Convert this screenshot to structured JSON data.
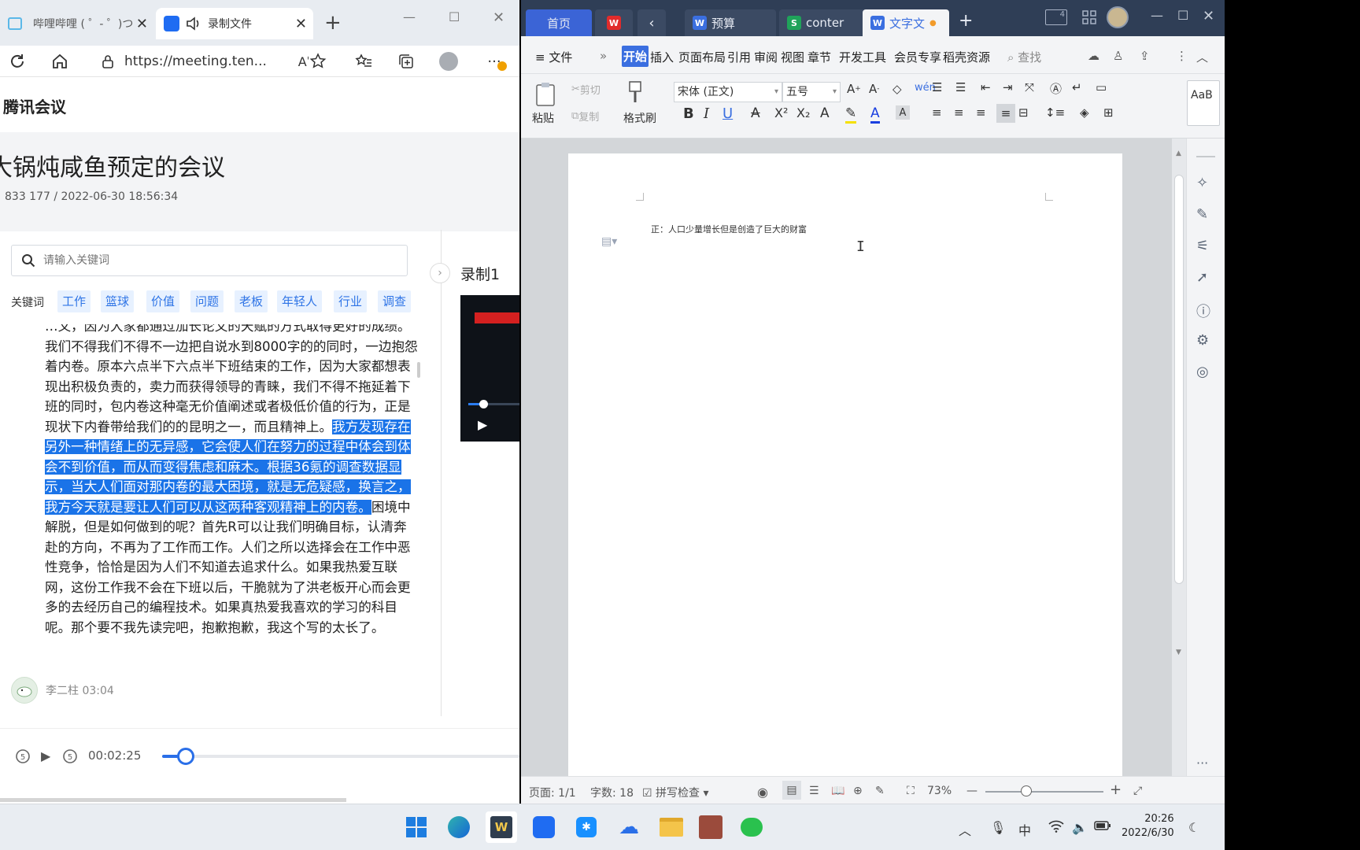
{
  "browser": {
    "tabs": [
      {
        "label": "哔哩哔哩 ( ゜- ゜)つ",
        "icon": "bilibili-icon"
      },
      {
        "label": "录制文件",
        "icon": "tencent-meeting-icon"
      }
    ],
    "url": "https://meeting.ten..."
  },
  "meeting": {
    "brand": "腾讯会议",
    "title": "大锅炖咸鱼预定的会议",
    "meta": "833 177 / 2022-06-30 18:56:34",
    "search_placeholder": "请输入关键词",
    "keywords_label": "关键词",
    "keywords": [
      "工作",
      "篮球",
      "价值",
      "问题",
      "老板",
      "年轻人",
      "行业",
      "调查"
    ],
    "transcript_before": "…文，因为大家都通过加长论文的天赋的方式取得更好的成绩。我们不得我们不得不一边把自说水到8000字的的同时，一边抱怨着内卷。原本六点半下六点半下班结束的工作，因为大家都想表现出积极负责的，卖力而获得领导的青睐，我们不得不拖延着下班的同时，包内卷这种毫无价值阐述或者极低价值的行为，正是现状下内眷带给我们的的昆明之一，而且精神上。",
    "transcript_highlight": "我方发现存在另外一种情绪上的无异感，它会使人们在努力的过程中体会到体会不到价值，而从而变得焦虑和麻木。根据36氪的调查数据显示，当大人们面对那内卷的最大困境，就是无危疑感，换言之，我方今天就是要让人们可以从这两种客观精神上的内卷。",
    "transcript_after": "困境中解脱，但是如何做到的呢？首先R可以让我们明确目标，认清奔赴的方向，不再为了工作而工作。人们之所以选择会在工作中恶性竞争，恰恰是因为人们不知道去追求什么。如果我热爱互联网，这份工作我不会在下班以后，干脆就为了洪老板开心而会更多的去经历自己的编程技术。如果真热爱我喜欢的学习的科目呢。那个要不我先读完吧，抱歉抱歉，我这个写的太长了。",
    "speaker": "李二柱 03:04",
    "recording_title": "录制1",
    "player_time": "00:02:25",
    "progress_fraction": 0.02
  },
  "wps": {
    "tabs": [
      {
        "label": "首页",
        "icon": ""
      },
      {
        "label": "",
        "icon": "wps-red-icon"
      },
      {
        "label": "预算",
        "icon": "wps-writer-icon"
      },
      {
        "label": "conter",
        "icon": "wps-sheet-icon"
      },
      {
        "label": "文字文",
        "icon": "wps-writer-icon"
      }
    ],
    "menu": {
      "file": "文件",
      "items": [
        "开始",
        "插入",
        "页面布局",
        "引用",
        "审阅",
        "视图",
        "章节",
        "开发工具",
        "会员专享",
        "稻壳资源"
      ],
      "search": "查找"
    },
    "ribbon": {
      "paste": "粘贴",
      "cut": "剪切",
      "copy": "复制",
      "format_painter": "格式刷",
      "font": "宋体 (正文)",
      "size": "五号",
      "style_preview": "AaB"
    },
    "document_text": "正：人口少量增长但是创造了巨大的财富",
    "status": {
      "page": "页面: 1/1",
      "words": "字数: 18",
      "spell": "拼写检查",
      "zoom": "73%"
    }
  },
  "taskbar": {
    "time": "20:26",
    "date": "2022/6/30",
    "ime": "中"
  }
}
